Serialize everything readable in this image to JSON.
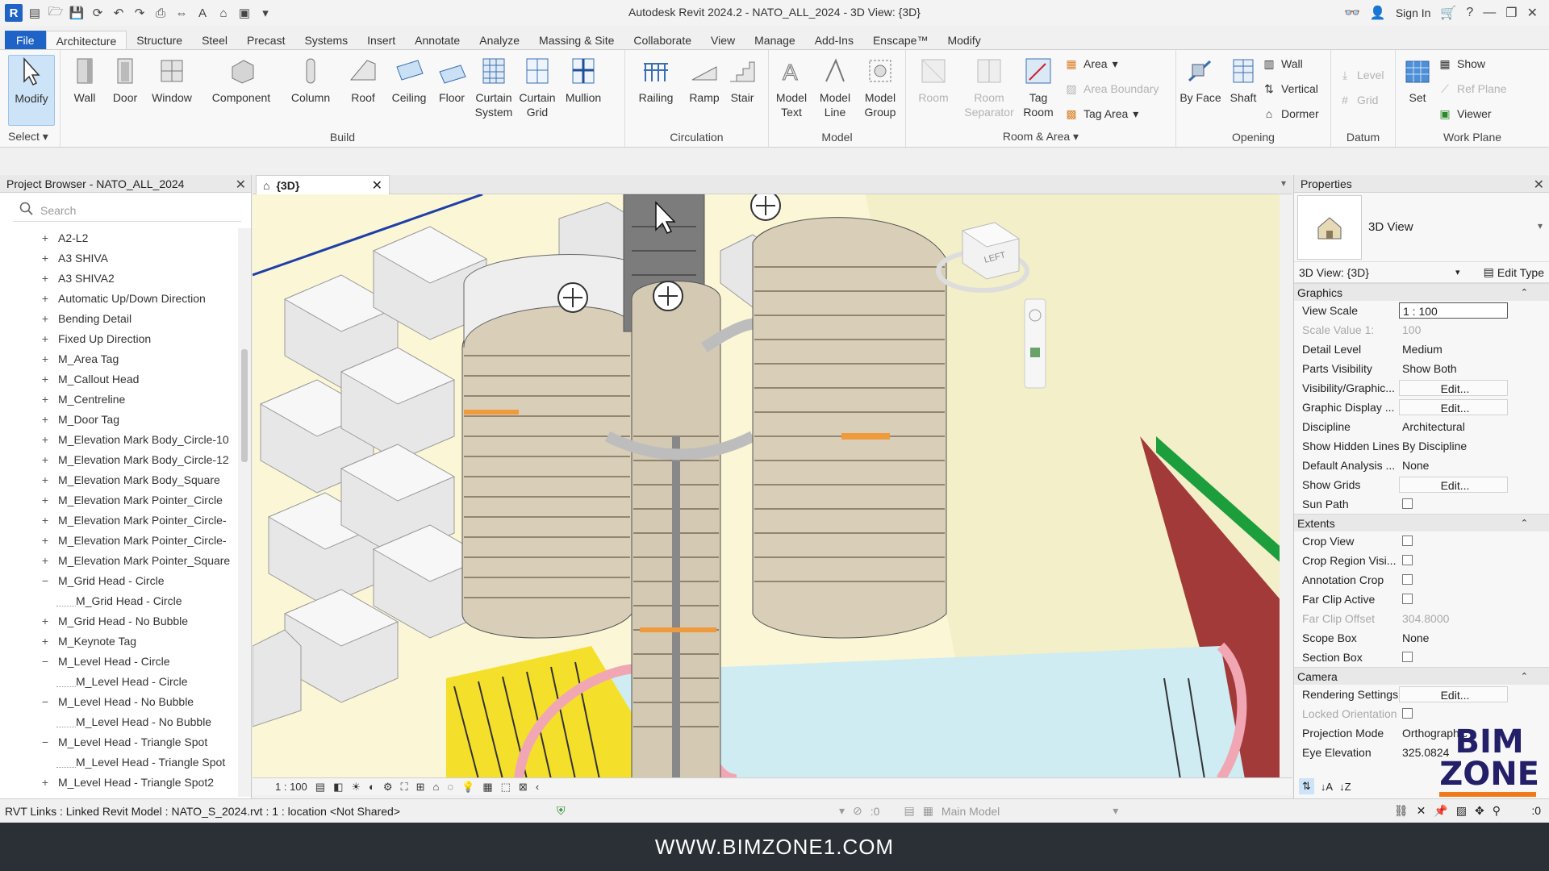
{
  "window": {
    "title": "Autodesk Revit 2024.2 - NATO_ALL_2024 - 3D View: {3D}",
    "sign_in": "Sign In"
  },
  "ribbon_tabs": [
    "File",
    "Architecture",
    "Structure",
    "Steel",
    "Precast",
    "Systems",
    "Insert",
    "Annotate",
    "Analyze",
    "Massing & Site",
    "Collaborate",
    "View",
    "Manage",
    "Add-Ins",
    "Enscape™",
    "Modify"
  ],
  "ribbon": {
    "select": {
      "modify": "Modify",
      "label": "Select"
    },
    "build": {
      "label": "Build",
      "buttons": [
        "Wall",
        "Door",
        "Window",
        "Component",
        "Column",
        "Roof",
        "Ceiling",
        "Floor",
        "Curtain System",
        "Curtain Grid",
        "Mullion"
      ]
    },
    "circulation": {
      "label": "Circulation",
      "buttons": [
        "Railing",
        "Ramp",
        "Stair"
      ]
    },
    "model": {
      "label": "Model",
      "buttons": [
        "Model Text",
        "Model Line",
        "Model Group"
      ]
    },
    "room_area": {
      "label": "Room & Area",
      "room": "Room",
      "room_separator": "Room Separator",
      "tag_room": "Tag Room",
      "area": "Area",
      "area_boundary": "Area Boundary",
      "tag_area": "Tag Area"
    },
    "opening": {
      "label": "Opening",
      "by_face": "By Face",
      "shaft": "Shaft",
      "wall": "Wall",
      "vertical": "Vertical",
      "dormer": "Dormer"
    },
    "datum": {
      "label": "Datum",
      "level": "Level",
      "grid": "Grid"
    },
    "work_plane": {
      "label": "Work Plane",
      "set": "Set",
      "show": "Show",
      "ref_plane": "Ref Plane",
      "viewer": "Viewer"
    }
  },
  "project_browser": {
    "title": "Project Browser - NATO_ALL_2024",
    "search_placeholder": "Search",
    "items": [
      {
        "label": "A2-L2",
        "toggle": "+",
        "level": 1
      },
      {
        "label": "A3 SHIVA",
        "toggle": "+",
        "level": 1
      },
      {
        "label": "A3 SHIVA2",
        "toggle": "+",
        "level": 1
      },
      {
        "label": "Automatic Up/Down Direction",
        "toggle": "+",
        "level": 1
      },
      {
        "label": "Bending Detail",
        "toggle": "+",
        "level": 1
      },
      {
        "label": "Fixed Up Direction",
        "toggle": "+",
        "level": 1
      },
      {
        "label": "M_Area Tag",
        "toggle": "+",
        "level": 1
      },
      {
        "label": "M_Callout Head",
        "toggle": "+",
        "level": 1
      },
      {
        "label": "M_Centreline",
        "toggle": "+",
        "level": 1
      },
      {
        "label": "M_Door Tag",
        "toggle": "+",
        "level": 1
      },
      {
        "label": "M_Elevation Mark Body_Circle-10",
        "toggle": "+",
        "level": 1
      },
      {
        "label": "M_Elevation Mark Body_Circle-12",
        "toggle": "+",
        "level": 1
      },
      {
        "label": "M_Elevation Mark Body_Square",
        "toggle": "+",
        "level": 1
      },
      {
        "label": "M_Elevation Mark Pointer_Circle",
        "toggle": "+",
        "level": 1
      },
      {
        "label": "M_Elevation Mark Pointer_Circle-",
        "toggle": "+",
        "level": 1
      },
      {
        "label": "M_Elevation Mark Pointer_Circle-",
        "toggle": "+",
        "level": 1
      },
      {
        "label": "M_Elevation Mark Pointer_Square",
        "toggle": "+",
        "level": 1
      },
      {
        "label": "M_Grid Head - Circle",
        "toggle": "−",
        "level": 1
      },
      {
        "label": "M_Grid Head - Circle",
        "toggle": "",
        "level": 2
      },
      {
        "label": "M_Grid Head - No Bubble",
        "toggle": "+",
        "level": 1
      },
      {
        "label": "M_Keynote Tag",
        "toggle": "+",
        "level": 1
      },
      {
        "label": "M_Level Head - Circle",
        "toggle": "−",
        "level": 1
      },
      {
        "label": "M_Level Head - Circle",
        "toggle": "",
        "level": 2
      },
      {
        "label": "M_Level Head - No Bubble",
        "toggle": "−",
        "level": 1
      },
      {
        "label": "M_Level Head - No Bubble",
        "toggle": "",
        "level": 2
      },
      {
        "label": "M_Level Head - Triangle Spot",
        "toggle": "−",
        "level": 1
      },
      {
        "label": "M_Level Head - Triangle Spot",
        "toggle": "",
        "level": 2
      },
      {
        "label": "M_Level Head - Triangle Spot2",
        "toggle": "+",
        "level": 1
      }
    ]
  },
  "view_tab": {
    "label": "{3D}"
  },
  "view_bar": {
    "scale": "1 : 100"
  },
  "properties": {
    "title": "Properties",
    "type_name": "3D View",
    "instance": "3D View: {3D}",
    "edit_type": "Edit Type",
    "groups": [
      {
        "name": "Graphics",
        "rows": [
          {
            "k": "View Scale",
            "v": "1 : 100",
            "style": "box"
          },
          {
            "k": "Scale Value    1:",
            "v": "100",
            "style": "dis"
          },
          {
            "k": "Detail Level",
            "v": "Medium",
            "style": ""
          },
          {
            "k": "Parts Visibility",
            "v": "Show Both",
            "style": ""
          },
          {
            "k": "Visibility/Graphic...",
            "v": "Edit...",
            "style": "btn"
          },
          {
            "k": "Graphic Display ...",
            "v": "Edit...",
            "style": "btn"
          },
          {
            "k": "Discipline",
            "v": "Architectural",
            "style": ""
          },
          {
            "k": "Show Hidden Lines",
            "v": "By Discipline",
            "style": ""
          },
          {
            "k": "Default Analysis ...",
            "v": "None",
            "style": ""
          },
          {
            "k": "Show Grids",
            "v": "Edit...",
            "style": "btn"
          },
          {
            "k": "Sun Path",
            "v": "",
            "style": "cb"
          }
        ]
      },
      {
        "name": "Extents",
        "rows": [
          {
            "k": "Crop View",
            "v": "",
            "style": "cb"
          },
          {
            "k": "Crop Region Visi...",
            "v": "",
            "style": "cb"
          },
          {
            "k": "Annotation Crop",
            "v": "",
            "style": "cb"
          },
          {
            "k": "Far Clip Active",
            "v": "",
            "style": "cb"
          },
          {
            "k": "Far Clip Offset",
            "v": "304.8000",
            "style": "dis"
          },
          {
            "k": "Scope Box",
            "v": "None",
            "style": ""
          },
          {
            "k": "Section Box",
            "v": "",
            "style": "cb"
          }
        ]
      },
      {
        "name": "Camera",
        "rows": [
          {
            "k": "Rendering Settings",
            "v": "Edit...",
            "style": "btn"
          },
          {
            "k": "Locked Orientation",
            "v": "",
            "style": "cbdis"
          },
          {
            "k": "Projection Mode",
            "v": "Orthographic",
            "style": ""
          },
          {
            "k": "Eye Elevation",
            "v": "325.0824",
            "style": ""
          }
        ]
      }
    ]
  },
  "watermark": {
    "line1": "BIM",
    "line2": "ZONE"
  },
  "status": {
    "text": "RVT Links : Linked Revit Model : NATO_S_2024.rvt : 1 : location <Not Shared>",
    "count": ":0",
    "main_model": "Main Model",
    "right_count": ":0"
  },
  "footer": {
    "url": "WWW.BIMZONE1.COM"
  },
  "colors": {
    "accent": "#1f63c6",
    "selection": "#cde3f7",
    "brand": "#231f69"
  }
}
